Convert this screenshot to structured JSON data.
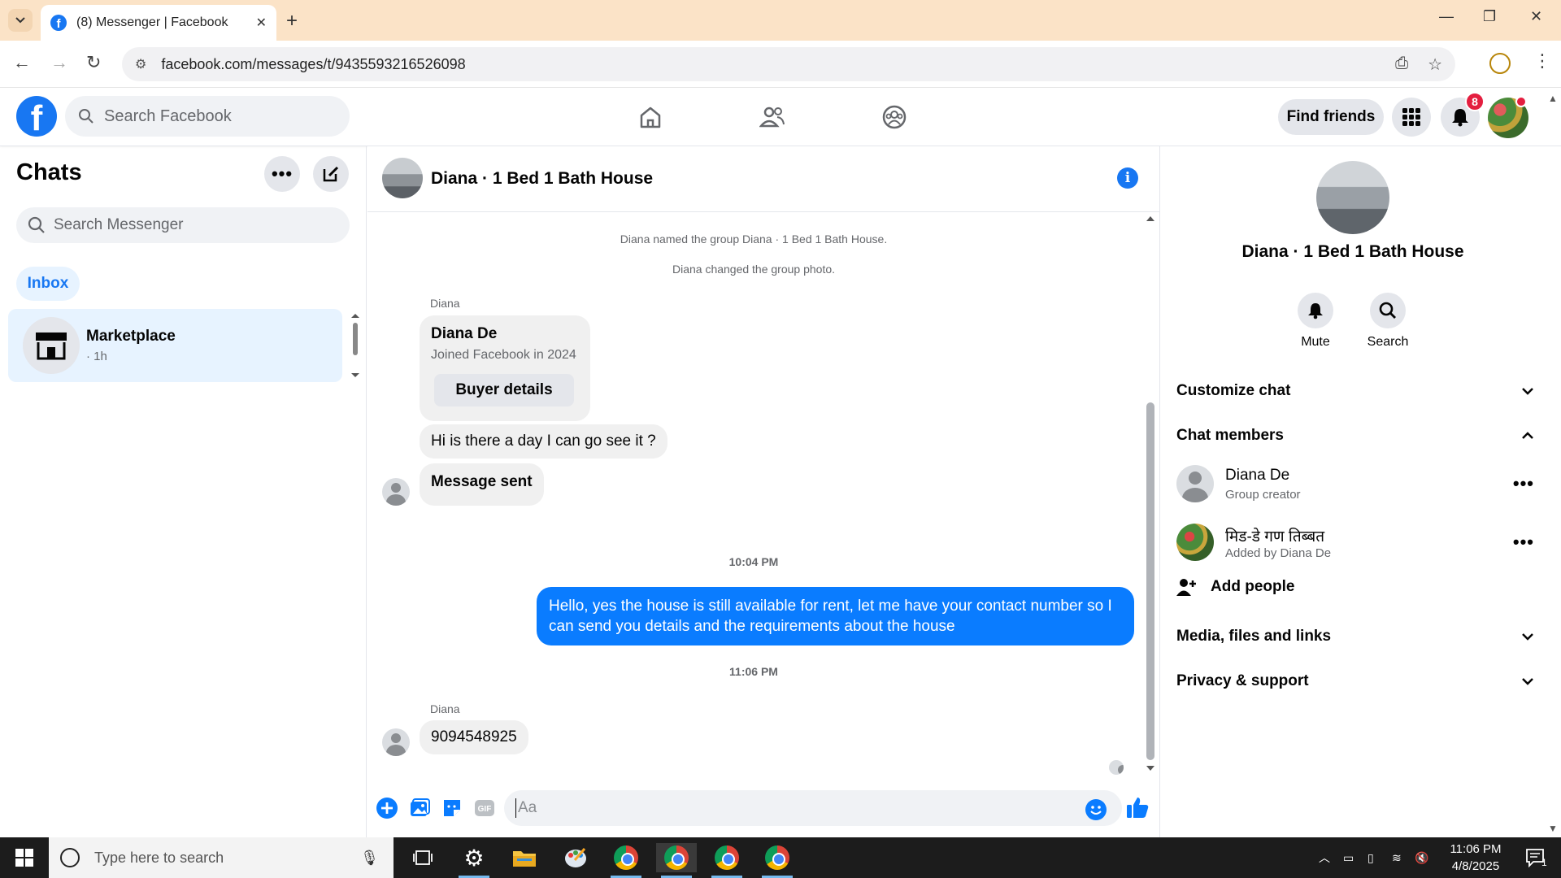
{
  "browser": {
    "tab_title": "(8) Messenger | Facebook",
    "url": "facebook.com/messages/t/9435593216526098"
  },
  "fb_header": {
    "search_placeholder": "Search Facebook",
    "find_friends": "Find friends",
    "notification_count": "8"
  },
  "left": {
    "title": "Chats",
    "search_placeholder": "Search Messenger",
    "inbox_label": "Inbox",
    "chats": [
      {
        "name": "Marketplace",
        "time": "· 1h"
      }
    ]
  },
  "conversation": {
    "title": "Diana · 1 Bed 1 Bath House",
    "system_messages": [
      "Diana named the group Diana · 1 Bed 1 Bath House.",
      "Diana changed the group photo."
    ],
    "sender_1": "Diana",
    "card_name": "Diana De",
    "card_sub": "Joined Facebook in 2024",
    "buyer_details": "Buyer details",
    "msg_1": "Hi is there a day I can go see it ?",
    "msg_2": "Message sent",
    "time_1": "10:04 PM",
    "msg_3": "Hello, yes the house is still available for rent, let me have your contact number so I can send you details and the requirements about the house",
    "time_2": "11:06 PM",
    "sender_2": "Diana",
    "msg_4": "9094548925",
    "composer_placeholder": "Aa"
  },
  "right": {
    "title": "Diana · 1 Bed 1 Bath House",
    "mute": "Mute",
    "search": "Search",
    "customize_chat": "Customize chat",
    "chat_members": "Chat members",
    "members": [
      {
        "name": "Diana De",
        "sub": "Group creator"
      },
      {
        "name": "मिड-डे गण तिब्बत",
        "sub": "Added by Diana De"
      }
    ],
    "add_people": "Add people",
    "media": "Media, files and links",
    "privacy": "Privacy & support"
  },
  "taskbar": {
    "search_placeholder": "Type here to search",
    "time": "11:06 PM",
    "date": "4/8/2025",
    "notif_count": "1"
  },
  "colors": {
    "brand": "#1877f2",
    "bubble_blue": "#0a7cff",
    "chrome_tabbar": "#fbe3c7"
  }
}
